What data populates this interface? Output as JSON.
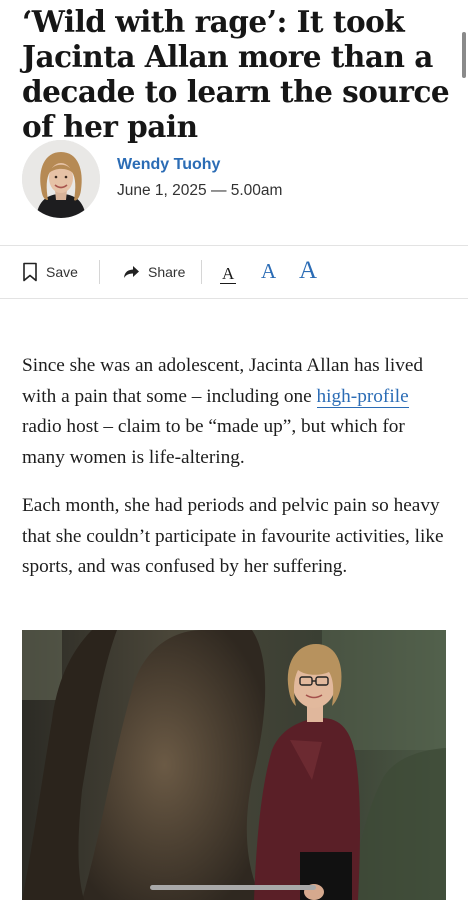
{
  "article": {
    "headline": "‘Wild with rage’: It took Jacinta Allan more than a decade to learn the source of her pain",
    "author": {
      "name": "Wendy Tuohy",
      "avatar_icon": "author-avatar"
    },
    "published": "June 1, 2025 — 5.00am",
    "paragraphs": [
      {
        "before_link": "Since she was an adolescent, Jacinta Allan has lived with a pain that some – including one ",
        "link_text": "high-profile",
        "after_link": " radio host – claim to be “made up”, but which for many women is life-altering."
      },
      {
        "text": "Each month, she had periods and pelvic pain so heavy that she couldn’t participate in favourite activities, like sports, and was confused by her suffering."
      }
    ]
  },
  "toolbar": {
    "save_label": "Save",
    "save_icon": "bookmark-icon",
    "share_label": "Share",
    "share_icon": "share-arrow-icon",
    "font_sizes": [
      "A",
      "A",
      "A"
    ],
    "selected_font_size": 0
  },
  "colors": {
    "accent": "#2b6cb5",
    "text": "#1d1d1d",
    "divider": "#e3e3e3"
  },
  "photo": {
    "subject": "photo of Jacinta Allan standing under large tree"
  }
}
